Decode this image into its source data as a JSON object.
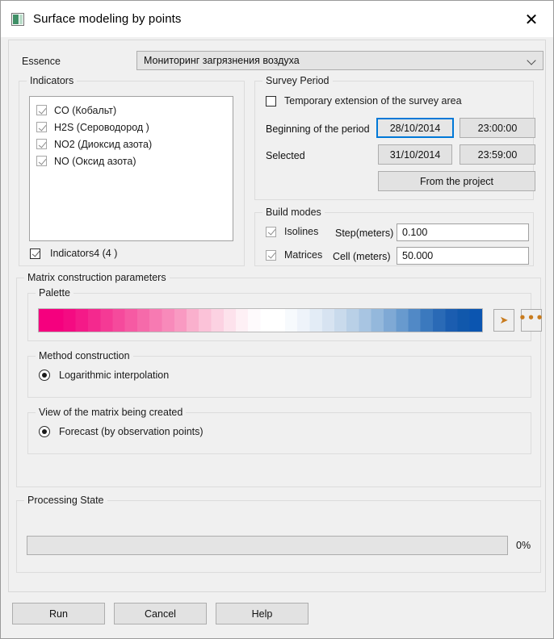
{
  "window": {
    "title": "Surface modeling by points",
    "app_icon": "surface-model-icon",
    "close_label": "✕"
  },
  "essence": {
    "label": "Essence",
    "value": "Мониторинг загрязнения воздуха"
  },
  "indicators": {
    "legend": "Indicators",
    "items": [
      {
        "label": "CO (Кобальт)",
        "checked": true
      },
      {
        "label": "H2S (Сероводород )",
        "checked": true
      },
      {
        "label": "NO2 (Диоксид азота)",
        "checked": true
      },
      {
        "label": "NO (Оксид азота)",
        "checked": true
      }
    ],
    "summary_label": "Indicators4 (4 )",
    "summary_checked": true
  },
  "survey_period": {
    "legend": "Survey Period",
    "temporary_extension_label": "Temporary extension of the survey area",
    "temporary_extension_checked": false,
    "beginning_label": "Beginning of the period",
    "beginning_date": "28/10/2014",
    "beginning_time": "23:00:00",
    "selected_label": "Selected",
    "selected_date": "31/10/2014",
    "selected_time": "23:59:00",
    "from_project_label": "From the project",
    "focus_color": "#0078d7"
  },
  "build_modes": {
    "legend": "Build modes",
    "isolines_label": "Isolines",
    "isolines_checked": true,
    "step_label": "Step(meters)",
    "step_value": "0.100",
    "matrices_label": "Matrices",
    "matrices_checked": true,
    "cell_label": "Cell (meters)",
    "cell_value": "50.000"
  },
  "matrix_params": {
    "legend": "Matrix construction parameters",
    "palette": {
      "legend": "Palette",
      "expand_glyph": "➤",
      "more_glyph": "•••",
      "accent_color": "#c87b1e",
      "stops": [
        "#f5007e",
        "#f5007e",
        "#f40b82",
        "#f41a88",
        "#f4298e",
        "#f53a95",
        "#f54a9c",
        "#f65aa3",
        "#f66aaa",
        "#f77ab2",
        "#f88aba",
        "#f99ac2",
        "#fab0cd",
        "#fbc2d8",
        "#fcd2e2",
        "#fde2ec",
        "#fef0f5",
        "#fefafc",
        "#ffffff",
        "#ffffff",
        "#f7fafd",
        "#eef3fa",
        "#e3ecf6",
        "#d7e3f1",
        "#c9daec",
        "#b9d0e7",
        "#a8c5e2",
        "#94b8dc",
        "#7fa9d5",
        "#689ace",
        "#5189c6",
        "#3b79be",
        "#2a6ab6",
        "#1b5db0",
        "#1158ac",
        "#0b55b0"
      ]
    },
    "method": {
      "legend": "Method construction",
      "option_label": "Logarithmic interpolation",
      "selected": true
    },
    "view": {
      "legend": "View of the matrix being created",
      "option_label": "Forecast (by observation points)",
      "selected": true
    }
  },
  "processing_state": {
    "legend": "Processing State",
    "percent_label": "0%",
    "progress": 0
  },
  "footer": {
    "run_label": "Run",
    "cancel_label": "Cancel",
    "help_label": "Help"
  }
}
